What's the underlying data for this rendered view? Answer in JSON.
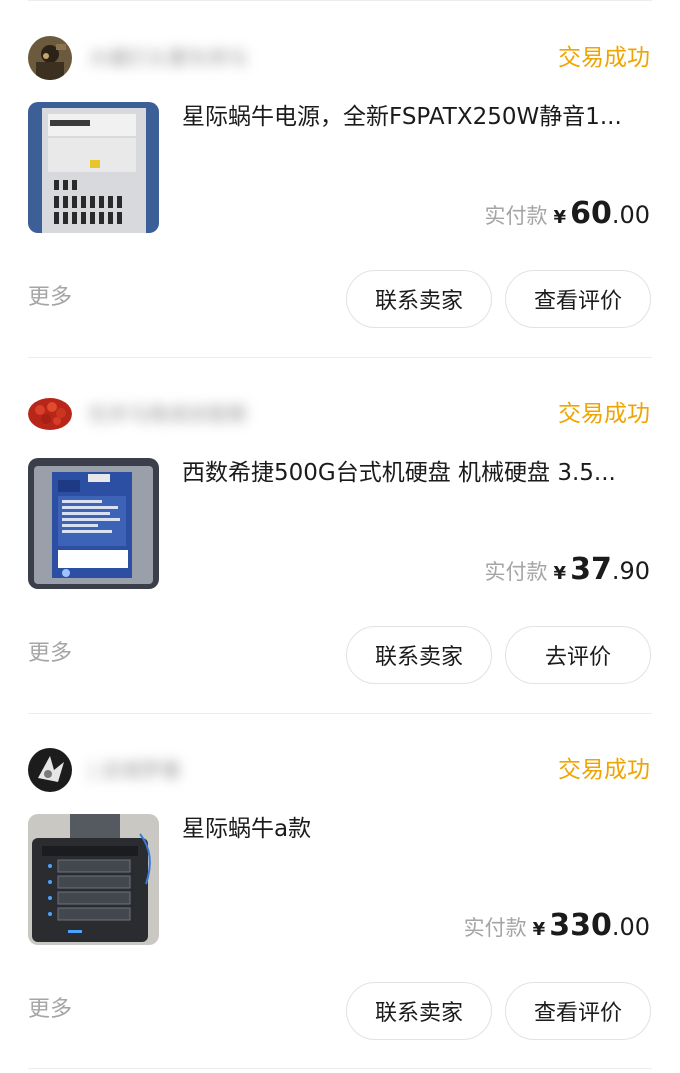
{
  "orders": [
    {
      "seller_name": "大橘打头要东邦与",
      "status": "交易成功",
      "title": "星际蜗牛电源，全新FSPATX250W静音1...",
      "price_label": "实付款",
      "currency": "¥",
      "price_int": "60",
      "price_dec": ".00",
      "more": "更多",
      "contact_label": "联系卖家",
      "review_label": "查看评价"
    },
    {
      "seller_name": "任并马南成尚智斯",
      "status": "交易成功",
      "title": "西数希捷500G台式机硬盘 机械硬盘 3.5...",
      "price_label": "实付款",
      "currency": "¥",
      "price_int": "37",
      "price_dec": ".90",
      "more": "更多",
      "contact_label": "联系卖家",
      "review_label": "去评价"
    },
    {
      "seller_name": "| 店城梦垂",
      "status": "交易成功",
      "title": "星际蜗牛a款",
      "price_label": "实付款",
      "currency": "¥",
      "price_int": "330",
      "price_dec": ".00",
      "more": "更多",
      "contact_label": "联系卖家",
      "review_label": "查看评价"
    }
  ],
  "colors": {
    "status": "#f0a400",
    "muted": "#a5a5a5",
    "border": "#e2e2e2"
  }
}
